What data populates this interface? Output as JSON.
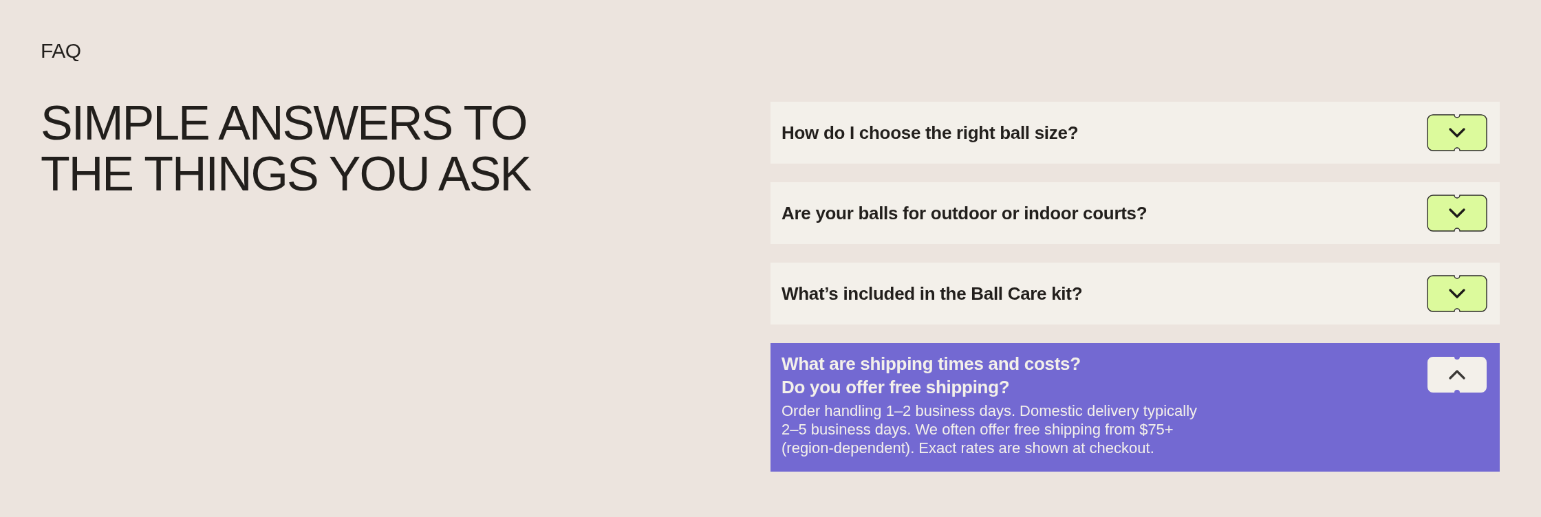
{
  "eyebrow": "FAQ",
  "heading": "SIMPLE ANSWERS TO\nTHE THINGS YOU ASK",
  "items": [
    {
      "question": "How do I choose the right ball size?",
      "expanded": false
    },
    {
      "question": "Are your balls for outdoor or indoor courts?",
      "expanded": false
    },
    {
      "question": "What’s included in the Ball Care kit?",
      "expanded": false
    },
    {
      "question": "What are shipping times and costs?\nDo you offer free shipping?",
      "expanded": true,
      "answer": "Order handling 1–2 business days. Domestic delivery typically 2–5 business days. We often offer free shipping from $75+ (region-dependent). Exact rates are shown at checkout."
    }
  ]
}
